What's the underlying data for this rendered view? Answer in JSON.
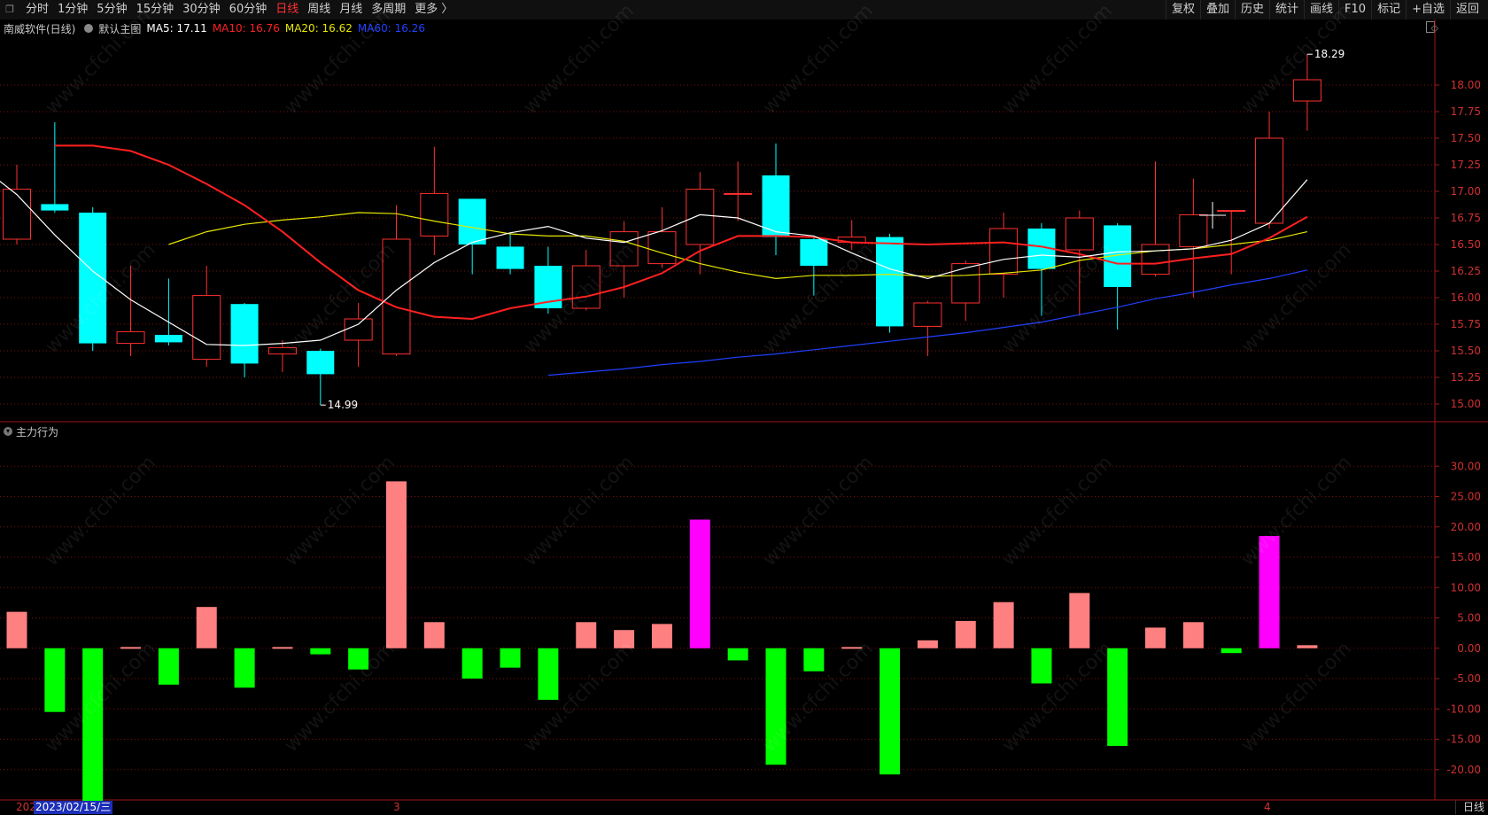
{
  "toolbar": {
    "tabs": [
      "分时",
      "1分钟",
      "5分钟",
      "15分钟",
      "30分钟",
      "60分钟",
      "日线",
      "周线",
      "月线",
      "多周期",
      "更多 〉"
    ],
    "active_tab": "日线",
    "tools": [
      "复权",
      "叠加",
      "历史",
      "统计",
      "画线",
      "F10",
      "标记",
      "+自选",
      "返回"
    ]
  },
  "info": {
    "stock": "南威软件(日线)",
    "template": "默认主图",
    "ma5_label": "MA5: 17.11",
    "ma10_label": "MA10: 16.76",
    "ma20_label": "MA20: 16.62",
    "ma60_label": "MA60: 16.26"
  },
  "colors": {
    "up": "#ff3030",
    "down": "#00ffff",
    "ma5": "#ffffff",
    "ma10": "#ff2020",
    "ma20": "#e6e600",
    "ma60": "#2040ff",
    "flow_pos": "#ff8080",
    "flow_pos_big": "#ff00ff",
    "flow_neg": "#00ff00"
  },
  "indicator": {
    "name": "主力行为"
  },
  "bottom": {
    "date_cursor": "2023/02/15/三",
    "year_fragment": "202",
    "month_3": "3",
    "month_4": "4",
    "period": "日线"
  },
  "chart_data": [
    {
      "type": "candlestick",
      "title": "南威软件(日线)",
      "ylim": [
        14.85,
        18.45
      ],
      "y_ticks": [
        "15.00",
        "15.25",
        "15.50",
        "15.75",
        "16.00",
        "16.25",
        "16.50",
        "16.75",
        "17.00",
        "17.25",
        "17.50",
        "17.75",
        "18.00"
      ],
      "annotations": {
        "high": "18.29",
        "low": "14.99"
      },
      "candles": [
        {
          "o": 16.55,
          "c": 17.02,
          "h": 17.25,
          "l": 16.5
        },
        {
          "o": 16.88,
          "c": 16.82,
          "h": 17.65,
          "l": 16.8
        },
        {
          "o": 16.8,
          "c": 15.57,
          "h": 16.85,
          "l": 15.5
        },
        {
          "o": 15.57,
          "c": 15.68,
          "h": 16.3,
          "l": 15.45
        },
        {
          "o": 15.65,
          "c": 15.58,
          "h": 16.18,
          "l": 15.55
        },
        {
          "o": 15.42,
          "c": 16.02,
          "h": 16.3,
          "l": 15.35
        },
        {
          "o": 15.94,
          "c": 15.38,
          "h": 15.95,
          "l": 15.25
        },
        {
          "o": 15.47,
          "c": 15.53,
          "h": 15.6,
          "l": 15.3
        },
        {
          "o": 15.5,
          "c": 15.28,
          "h": 15.52,
          "l": 14.99
        },
        {
          "o": 15.6,
          "c": 15.8,
          "h": 15.95,
          "l": 15.35
        },
        {
          "o": 15.47,
          "c": 16.55,
          "h": 16.87,
          "l": 15.45
        },
        {
          "o": 16.58,
          "c": 16.98,
          "h": 17.42,
          "l": 16.4
        },
        {
          "o": 16.93,
          "c": 16.5,
          "h": 16.93,
          "l": 16.22
        },
        {
          "o": 16.48,
          "c": 16.27,
          "h": 16.6,
          "l": 16.22
        },
        {
          "o": 16.3,
          "c": 15.9,
          "h": 16.48,
          "l": 15.85
        },
        {
          "o": 15.9,
          "c": 16.3,
          "h": 16.45,
          "l": 15.88
        },
        {
          "o": 16.3,
          "c": 16.62,
          "h": 16.72,
          "l": 16.0
        },
        {
          "o": 16.32,
          "c": 16.62,
          "h": 16.85,
          "l": 16.28
        },
        {
          "o": 16.5,
          "c": 17.02,
          "h": 17.18,
          "l": 16.22
        },
        {
          "o": 16.98,
          "c": 16.98,
          "h": 17.28,
          "l": 16.72
        },
        {
          "o": 17.15,
          "c": 16.57,
          "h": 17.45,
          "l": 16.4
        },
        {
          "o": 16.55,
          "c": 16.3,
          "h": 16.57,
          "l": 16.02
        },
        {
          "o": 16.52,
          "c": 16.57,
          "h": 16.73,
          "l": 16.45
        },
        {
          "o": 16.57,
          "c": 15.73,
          "h": 16.6,
          "l": 15.67
        },
        {
          "o": 15.73,
          "c": 15.95,
          "h": 15.97,
          "l": 15.45
        },
        {
          "o": 15.95,
          "c": 16.32,
          "h": 16.35,
          "l": 15.78
        },
        {
          "o": 16.22,
          "c": 16.65,
          "h": 16.8,
          "l": 16.0
        },
        {
          "o": 16.65,
          "c": 16.27,
          "h": 16.7,
          "l": 15.83
        },
        {
          "o": 16.45,
          "c": 16.75,
          "h": 16.82,
          "l": 15.83
        },
        {
          "o": 16.68,
          "c": 16.1,
          "h": 16.7,
          "l": 15.7
        },
        {
          "o": 16.22,
          "c": 16.5,
          "h": 17.28,
          "l": 16.2
        },
        {
          "o": 16.48,
          "c": 16.78,
          "h": 17.12,
          "l": 16.0
        },
        {
          "o": 16.82,
          "c": 16.82,
          "h": 16.82,
          "l": 16.22
        },
        {
          "o": 16.7,
          "c": 17.5,
          "h": 17.75,
          "l": 16.65
        },
        {
          "o": 17.85,
          "c": 18.05,
          "h": 18.29,
          "l": 17.57
        }
      ],
      "ma5": [
        17.25,
        16.97,
        16.59,
        16.25,
        15.98,
        15.77,
        15.56,
        15.55,
        15.57,
        15.6,
        15.75,
        16.07,
        16.33,
        16.52,
        16.61,
        16.67,
        16.56,
        16.52,
        16.63,
        16.78,
        16.75,
        16.62,
        16.58,
        16.42,
        16.27,
        16.18,
        16.28,
        16.36,
        16.4,
        16.38,
        16.43,
        16.44,
        16.46,
        16.54,
        16.7,
        17.11
      ],
      "ma10": [
        17.43,
        17.43,
        17.38,
        17.25,
        17.07,
        16.87,
        16.62,
        16.33,
        16.07,
        15.91,
        15.82,
        15.8,
        15.9,
        15.96,
        16.01,
        16.1,
        16.23,
        16.44,
        16.58,
        16.58,
        16.57,
        16.52,
        16.51,
        16.5,
        16.51,
        16.52,
        16.48,
        16.41,
        16.32,
        16.32,
        16.37,
        16.41,
        16.56,
        16.76
      ],
      "ma20": [
        16.5,
        16.62,
        16.69,
        16.73,
        16.76,
        16.8,
        16.79,
        16.72,
        16.66,
        16.6,
        16.58,
        16.58,
        16.53,
        16.42,
        16.32,
        16.24,
        16.18,
        16.21,
        16.21,
        16.22,
        16.2,
        16.21,
        16.23,
        16.26,
        16.35,
        16.4,
        16.44,
        16.46,
        16.5,
        16.54,
        16.62
      ],
      "ma60": [
        15.27,
        15.3,
        15.33,
        15.37,
        15.4,
        15.44,
        15.47,
        15.51,
        15.55,
        15.59,
        15.63,
        15.67,
        15.72,
        15.77,
        15.84,
        15.91,
        15.99,
        16.05,
        16.12,
        16.18,
        16.26
      ]
    },
    {
      "type": "bar",
      "title": "主力行为",
      "ylim": [
        -25,
        35
      ],
      "y_ticks": [
        "30.00",
        "25.00",
        "20.00",
        "15.00",
        "10.00",
        "5.00",
        "0.00",
        "-5.00",
        "-10.00",
        "-15.00",
        "-20.00"
      ],
      "values": [
        6.0,
        -10.5,
        -25.5,
        0.2,
        -6.0,
        6.8,
        -6.5,
        0.2,
        -1.0,
        -3.5,
        27.5,
        4.3,
        -5.0,
        -3.2,
        -8.5,
        4.3,
        3.0,
        4.0,
        21.2,
        -2.0,
        -19.2,
        -3.8,
        0.2,
        -20.8,
        1.3,
        4.5,
        7.6,
        -5.8,
        9.1,
        -16.1,
        3.4,
        4.3,
        -0.8,
        18.5,
        0.5
      ]
    }
  ]
}
